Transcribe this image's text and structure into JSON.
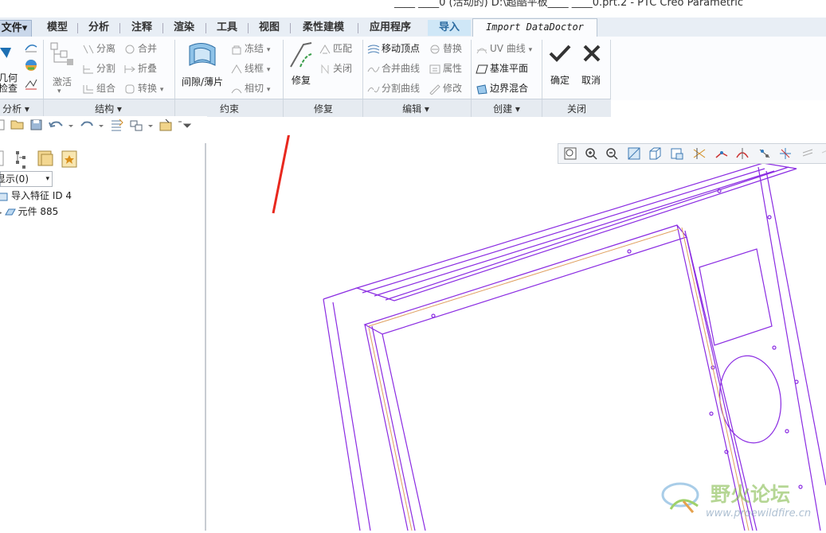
{
  "title_bar": {
    "text": "____  ____0 (活动的) D:\\超酷平板____ ____0.prt.2 - PTC Creo Parametric"
  },
  "tabs": [
    {
      "label": "文件▾"
    },
    {
      "label": "模型"
    },
    {
      "label": "分析"
    },
    {
      "label": "注释"
    },
    {
      "label": "渲染"
    },
    {
      "label": "工具"
    },
    {
      "label": "视图"
    },
    {
      "label": "柔性建模"
    },
    {
      "label": "应用程序"
    },
    {
      "label": "导入"
    },
    {
      "label": "Import DataDoctor"
    }
  ],
  "ribbon": {
    "analysis": {
      "big_label_1": "几何",
      "big_label_2": "检查",
      "group": "分析 ▾"
    },
    "structure": {
      "activate": "激活",
      "separate": "分离",
      "merge": "合并",
      "split": "分割",
      "fold": "折叠",
      "combine": "组合",
      "convert": "转换",
      "group": "结构 ▾"
    },
    "constraint": {
      "gap_sheet": "间隙/薄片",
      "freeze": "冻结",
      "wireframe": "线框",
      "tangent": "相切",
      "group": "约束"
    },
    "repair": {
      "repair": "修复",
      "match": "匹配",
      "close": "关闭",
      "group": "修复"
    },
    "edit": {
      "move_vertex": "移动顶点",
      "replace": "替换",
      "merge_curve": "合并曲线",
      "property": "属性",
      "split_curve": "分割曲线",
      "modify": "修改",
      "group": "编辑 ▾"
    },
    "create": {
      "uv_curve": "UV 曲线",
      "datum_plane": "基准平面",
      "boundary_blend": "边界混合",
      "group": "创建 ▾"
    },
    "close": {
      "confirm": "确定",
      "cancel": "取消",
      "group": "关闭"
    }
  },
  "model_tree": {
    "filter": "显示(0)",
    "items": [
      {
        "label": "导入特征 ID 4"
      },
      {
        "label": "元件 885"
      }
    ]
  },
  "watermark": {
    "text": "野火论坛",
    "url": "www.proewildfire.cn"
  },
  "colors": {
    "accent": "#8a2be2",
    "arrow": "#e8281e",
    "tab_bg": "#e8eef5"
  }
}
